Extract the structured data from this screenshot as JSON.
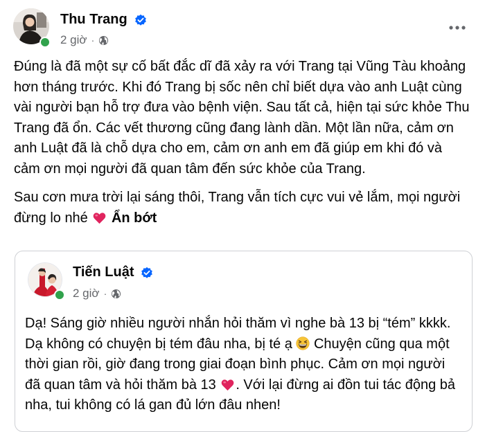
{
  "post": {
    "author": "Thu Trang",
    "time": "2 giờ",
    "separator": "·",
    "paragraphs": [
      "Đúng là đã một sự cố bất đắc dĩ đã xảy ra với Trang tại Vũng Tàu khoảng hơn tháng trước. Khi đó Trang bị sốc nên chỉ biết dựa vào anh Luật cùng vài người bạn hỗ trợ đưa vào bệnh viện. Sau tất cả, hiện tại sức khỏe Thu Trang đã ổn. Các vết thương cũng đang lành dần. Một lần nữa, cảm ơn anh Luật đã là chỗ dựa cho em, cảm ơn anh em đã giúp em khi đó và cảm ơn mọi người đã quan tâm đến sức khỏe của Trang.",
      "Sau cơn mưa trời lại sáng thôi, Trang vẫn tích cực vui vẻ lắm, mọi người đừng lo nhé"
    ],
    "see_less": "Ẩn bớt"
  },
  "shared_post": {
    "author": "Tiến Luật",
    "time": "2 giờ",
    "separator": "·",
    "text_part1": "Dạ! Sáng giờ nhiều người nhắn hỏi thăm vì nghe bà 13 bị “tém” kkkk. Dạ không có chuyện bị tém đâu nha, bị té ạ",
    "text_part2": "Chuyện cũng qua một thời gian rồi, giờ đang trong giai đoạn bình phục. Cảm ơn mọi người đã quan tâm và hỏi thăm bà 13",
    "text_part3": ". Với lại đừng ai đồn tui tác động bả nha, tui không có lá gan đủ lớn đâu nhen!"
  },
  "icons": {
    "verified": "verified-badge-icon",
    "privacy": "globe-icon",
    "more": "more-options-icon",
    "heart": "red-heart-emoji",
    "grin": "grinning-squinting-face-emoji"
  },
  "colors": {
    "accent": "#0866ff",
    "secondary_text": "#65676b",
    "online": "#31a24c",
    "heart": "#e0245e"
  }
}
